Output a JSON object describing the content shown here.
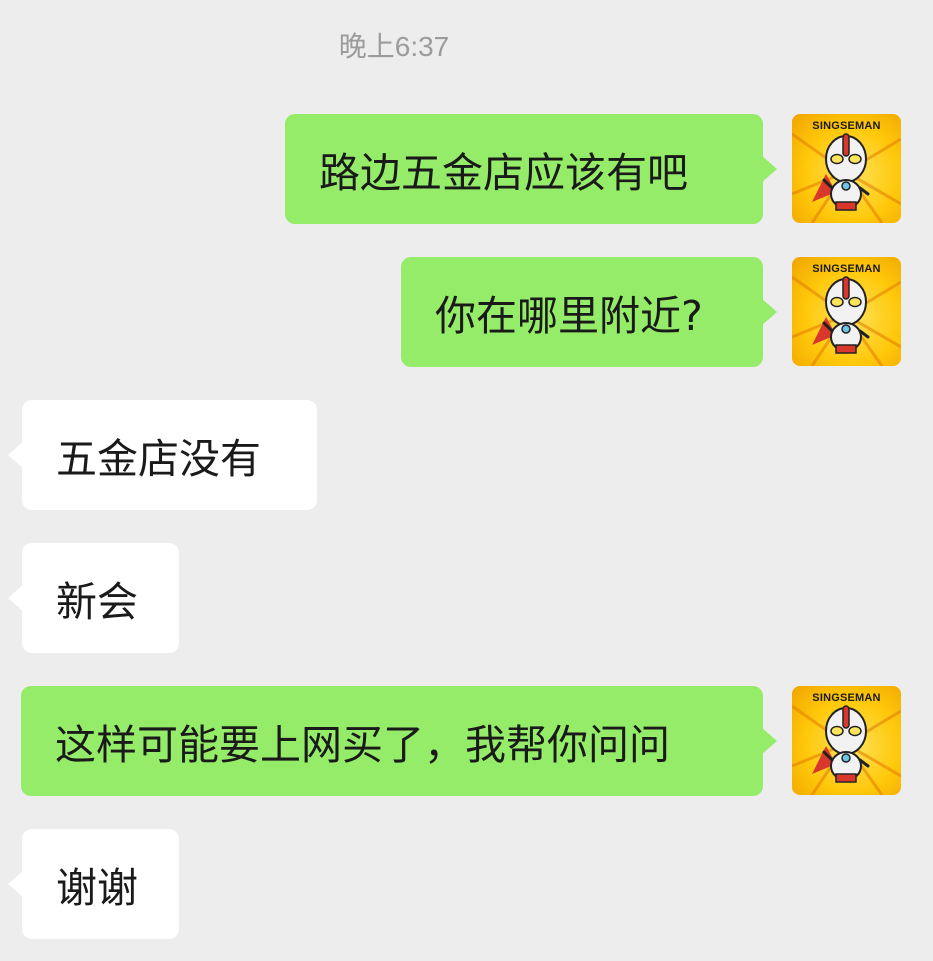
{
  "timestamp": "晚上6:37",
  "avatar": {
    "label": "SINGSEMAN",
    "icon": "ultraman-cartoon-avatar"
  },
  "colors": {
    "background": "#ededed",
    "sent_bubble": "#95ec69",
    "received_bubble": "#ffffff",
    "timestamp_text": "#9b9b9b"
  },
  "messages": [
    {
      "direction": "sent",
      "text": "路边五金店应该有吧"
    },
    {
      "direction": "sent",
      "text": "你在哪里附近?"
    },
    {
      "direction": "received",
      "text": "五金店没有"
    },
    {
      "direction": "received",
      "text": "新会"
    },
    {
      "direction": "sent",
      "text": "这样可能要上网买了，我帮你问问"
    },
    {
      "direction": "received",
      "text": "谢谢"
    }
  ]
}
